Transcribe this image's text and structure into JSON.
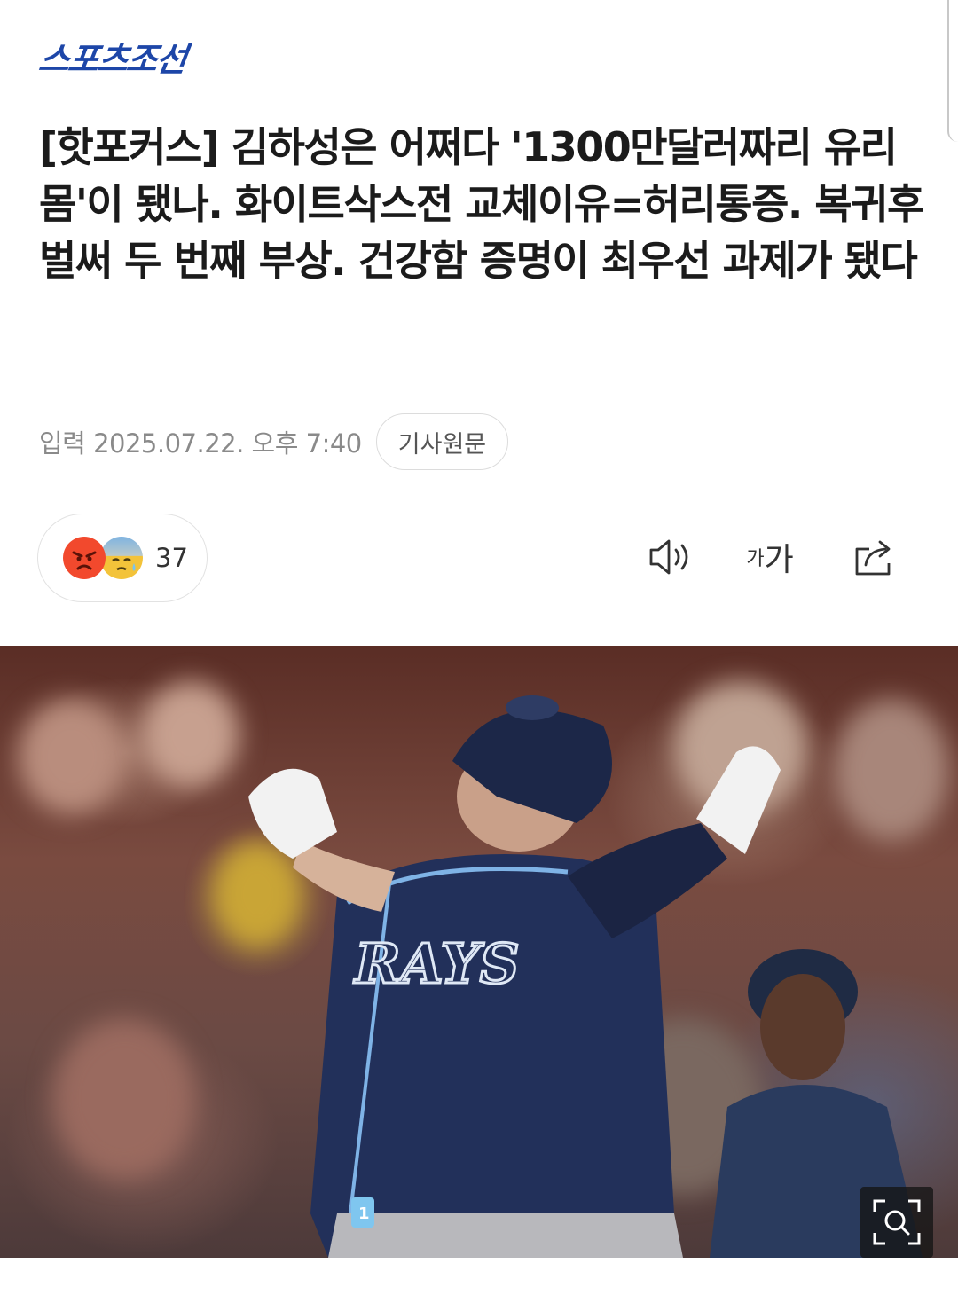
{
  "brand": {
    "name": "스포츠조선",
    "color": "#1d46a8"
  },
  "article": {
    "headline": "[핫포커스] 김하성은 어쩌다 '1300만달러짜리 유리몸'이 됐나. 화이트삭스전 교체이유=허리통증. 복귀후 벌써 두 번째 부상. 건강함 증명이 최우선 과제가 됐다",
    "published": "입력 2025.07.22. 오후 7:40",
    "source_button": "기사원문"
  },
  "reactions": {
    "count": "37",
    "emojis": [
      "angry-face-icon",
      "sad-sweat-face-icon"
    ]
  },
  "toolbar": {
    "speaker_icon": "speaker-icon",
    "font_small": "가",
    "font_large": "가",
    "share_icon": "share-icon"
  },
  "photo": {
    "description_icon": "photo-zoom-icon",
    "jersey_text": "RAYS",
    "jersey_number": "1"
  }
}
